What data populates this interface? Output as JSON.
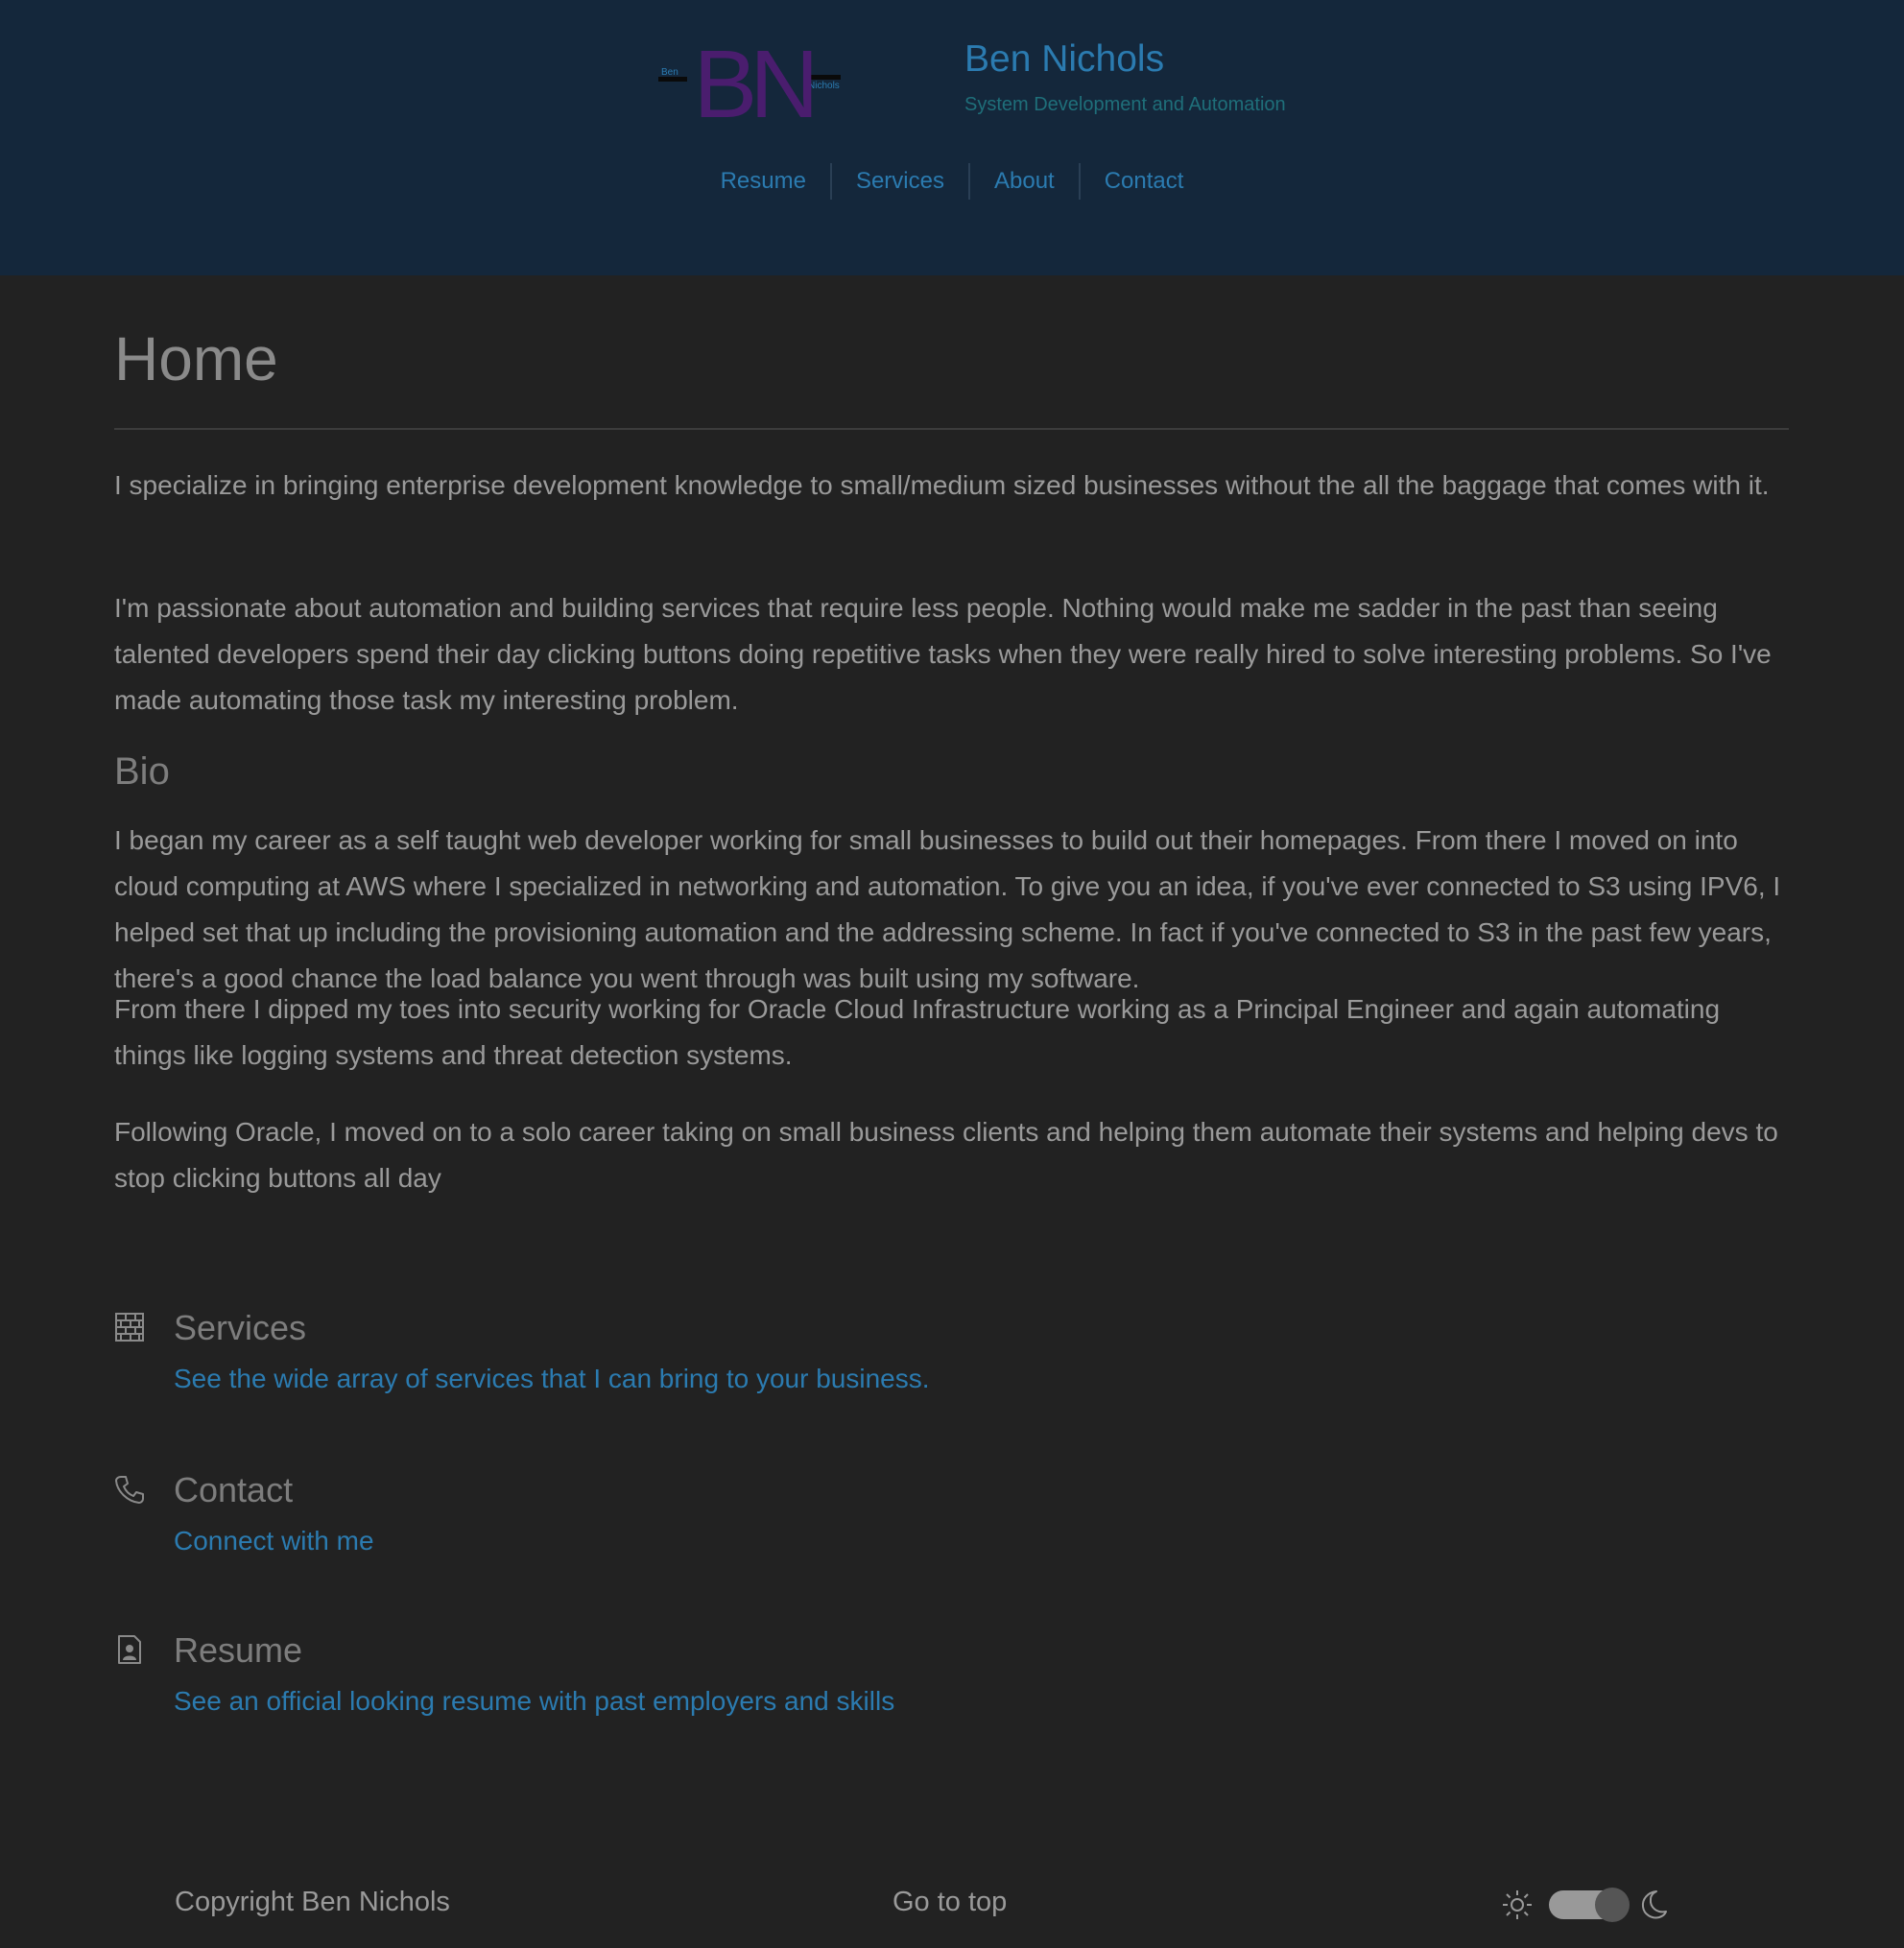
{
  "header": {
    "logo": {
      "big_letters": "BN",
      "first_name": "Ben",
      "last_name": "Nichols"
    },
    "title": "Ben Nichols",
    "subtitle": "System Development and Automation",
    "nav": [
      {
        "label": "Resume"
      },
      {
        "label": "Services"
      },
      {
        "label": "About"
      },
      {
        "label": "Contact"
      }
    ]
  },
  "main": {
    "page_title": "Home",
    "intro": [
      "I specialize in bringing enterprise development knowledge to small/medium sized businesses without the all the baggage that comes with it.",
      "I'm passionate about automation and building services that require less people. Nothing would make me sadder in the past than seeing talented developers spend their day clicking buttons doing repetitive tasks when they were really hired to solve interesting problems. So I've made automating those task my interesting problem."
    ],
    "bio_heading": "Bio",
    "bio": [
      "I began my career as a self taught web developer working for small businesses to build out their homepages. From there I moved on into cloud computing at AWS where I specialized in networking and automation. To give you an idea, if you've ever connected to S3 using IPV6, I helped set that up including the provisioning automation and the addressing scheme. In fact if you've connected to S3 in the past few years, there's a good chance the load balance you went through was built using my software.",
      "From there I dipped my toes into security working for Oracle Cloud Infrastructure working as a Principal Engineer and again automating things like logging systems and threat detection systems.",
      "Following Oracle, I moved on to a solo career taking on small business clients and helping them automate their systems and helping devs to stop clicking buttons all day"
    ],
    "features": [
      {
        "icon": "brick-wall-icon",
        "title": "Services",
        "link": "See the wide array of services that I can bring to your business."
      },
      {
        "icon": "phone-icon",
        "title": "Contact",
        "link": "Connect with me"
      },
      {
        "icon": "resume-file-icon",
        "title": "Resume",
        "link": "See an official looking resume with past employers and skills"
      }
    ]
  },
  "footer": {
    "copyright": "Copyright Ben Nichols",
    "go_to_top": "Go to top",
    "theme_toggle": {
      "state": "dark"
    }
  },
  "colors": {
    "header_bg": "#14273b",
    "page_bg": "#222222",
    "link": "#2b7bb0",
    "logo_purple": "#4a1d6e"
  }
}
